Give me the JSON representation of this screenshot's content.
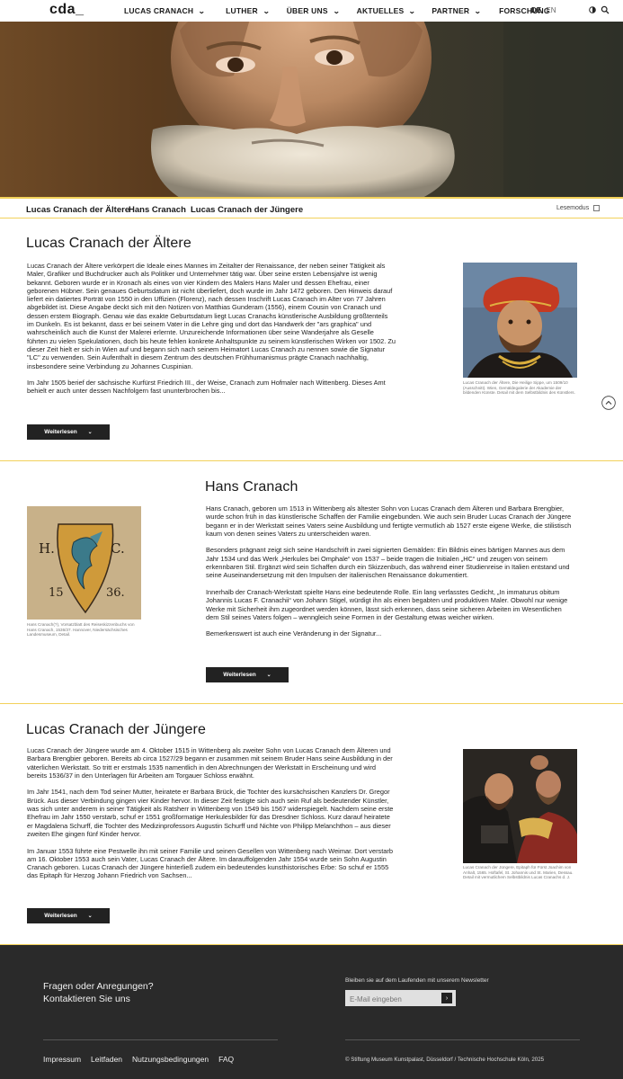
{
  "header": {
    "logo": "cda_",
    "nav": [
      {
        "label": "LUCAS CRANACH",
        "has_dropdown": true
      },
      {
        "label": "LUTHER",
        "has_dropdown": true
      },
      {
        "label": "ÜBER UNS",
        "has_dropdown": true
      },
      {
        "label": "AKTUELLES",
        "has_dropdown": true
      },
      {
        "label": "PARTNER",
        "has_dropdown": true
      },
      {
        "label": "FORSCHUNG",
        "has_dropdown": false
      }
    ],
    "lang_active": "DE",
    "lang_other": "EN",
    "icons": [
      "theme-toggle-icon",
      "search-icon"
    ]
  },
  "subnav": {
    "items": [
      "Lucas Cranach der Ältere",
      "Hans Cranach",
      "Lucas Cranach der Jüngere"
    ],
    "reading_mode_label": "Lesemodus"
  },
  "sections": [
    {
      "title": "Lucas Cranach der Ältere",
      "paragraphs": [
        "Lucas Cranach der Ältere verkörpert die Ideale eines Mannes im  Zeitalter der Renaissance, der neben seiner Tätigkeit als Maler,  Grafiker und Buchdrucker auch als Politiker und Unternehmer tätig war.  Über seine ersten Lebensjahre ist wenig bekannt. Geboren wurde er in  Kronach als eines von vier Kindern des Malers Hans Maler und dessen  Ehefrau, einer geborenen Hübner. Sein genaues Geburtsdatum ist nicht  überliefert, doch wurde im Jahr 1472 geboren. Den Hinweis darauf liefert ein datiertes Porträt von 1550 in den Uffizien (Florenz), nach dessen  Inschrift Lucas Cranach im Alter von 77 Jahren abgebildet ist. Diese  Angabe deckt sich mit den Notizen von Matthias Gunderam (1556), einem Cousin von Cranach und dessen erstem Biograph. Genau wie das exakte Geburtsdatum liegt Lucas Cranachs künstlerische  Ausbildung größtenteils im Dunkeln. Es ist bekannt, dass er bei seinem  Vater in die Lehre ging und dort das Handwerk der \"ars graphica\" und  wahrscheinlich auch die Kunst der Malerei erlernte. Unzureichende Informationen über seine Wanderjahre als Geselle führten zu vielen  Spekulationen, doch bis heute fehlen konkrete Anhaltspunkte zu seinem  künstlerischen Wirken vor 1502. Zu dieser Zeit hielt er sich in Wien auf und begann sich nach seinem Heimatort Lucas Cranach zu nennen sowie die Signatur \"LC\" zu verwenden. Sein Aufenthalt in diesem Zentrum des  deutschen Frühhumanismus prägte Cranach nachhaltig, insbesondere seine  Verbindung zu Johannes Cuspinian.",
        "Im Jahr 1505 berief der sächsische Kurfürst Friedrich III., der  Weise, Cranach zum Hofmaler nach Wittenberg. Dieses Amt behielt er auch  unter dessen Nachfolgern fast ununterbrochen bis..."
      ],
      "caption": "Lucas Cranach der Ältere, Die Heilige Sippe, um 1509/10 (Ausschnitt). Wien, Gemäldegalerie der Akademie der bildenden Künste. Detail mit dem Selbstbildnis des Künstlers.",
      "button_label": "Weiterlesen"
    },
    {
      "title": "Hans Cranach",
      "paragraphs": [
        "Hans Cranach, geboren um 1513 in Wittenberg als ältester Sohn von Lucas Cranach dem Älteren und Barbara Brengbier, wurde schon früh in das künstlerische Schaffen der Familie eingebunden. Wie auch sein Bruder Lucas Cranach der Jüngere begann er in der Werkstatt seines Vaters seine Ausbildung und fertigte vermutlich ab 1527 erste eigene Werke, die stilistisch kaum von denen seines Vaters zu unterscheiden waren.",
        "Besonders prägnant zeigt sich seine Handschrift in zwei signierten Gemälden: Ein Bildnis eines bärtigen Mannes aus dem Jahr 1534 und das Werk „Herkules bei Omphale“ von 1537 – beide tragen die Initialen „HC“ und zeugen von seinem erkennbaren Stil. Ergänzt wird sein Schaffen durch ein Skizzenbuch, das während einer Studienreise in Italien entstand und seine Auseinandersetzung mit den Impulsen der italienischen Renaissance dokumentiert.",
        "Innerhalb der Cranach-Werkstatt spielte Hans eine bedeutende Rolle. Ein lang verfasstes Gedicht, „In immaturus obitum Johannis Lucas F. Cranachii“ von Johann Stigel, würdigt ihn als einen begabten und produktiven Maler. Obwohl nur wenige Werke mit Sicherheit ihm zugeordnet werden können, lässt sich erkennen, dass seine sicheren Arbeiten im Wesentlichen dem Stil seines Vaters folgen – wenngleich seine Formen in der Gestaltung etwas weicher wirken.",
        "Bemerkenswert ist auch eine Veränderung in der Signatur..."
      ],
      "image_text": {
        "h": "H.",
        "c": "C.",
        "year_a": "15",
        "year_b": "36."
      },
      "caption": "Hans Cranach(?), Vorsatzblatt des Reiseskizzenbuchs von Hans Cranach, 1536/37. Hannover, Niedersächsisches Landesmuseum, Detail.",
      "button_label": "Weiterlesen"
    },
    {
      "title": "Lucas Cranach der Jüngere",
      "paragraphs": [
        "Lucas Cranach der Jüngere wurde am 4. Oktober 1515 in Wittenberg als zweiter Sohn von Lucas Cranach dem Älteren und Barbara Brengbier geboren. Bereits ab circa 1527/29 begann er zusammen mit seinem Bruder Hans seine Ausbildung in der väterlichen Werkstatt. So tritt er erstmals 1535 namentlich in den Abrechnungen der Werkstatt in Erscheinung und wird bereits 1536/37 in den Unterlagen für Arbeiten am Torgauer Schloss erwähnt.",
        "Im Jahr 1541, nach dem Tod seiner Mutter, heiratete er Barbara Brück, die Tochter des kursächsischen Kanzlers Dr. Gregor Brück. Aus dieser Verbindung gingen vier Kinder hervor. In dieser Zeit festigte sich auch sein Ruf als bedeutender Künstler, was sich unter anderem in seiner Tätigkeit als Ratsherr in Wittenberg von 1549 bis 1567 widerspiegelt. Nachdem seine erste Ehefrau im Jahr 1550 verstarb, schuf er 1551 großformatige Herkulesbilder für das Dresdner Schloss. Kurz darauf heiratete er Magdalena Schurff, die Tochter des Medizinprofessors Augustin Schurff und Nichte von Philipp Melanchthon – aus dieser zweiten Ehe gingen fünf Kinder hervor.",
        "Im Januar 1553 führte eine Pestwelle ihn mit seiner Familie und seinen Gesellen von Wittenberg nach Weimar. Dort verstarb am 16. Oktober 1553 auch sein Vater, Lucas Cranach der Ältere. Im darauffolgenden Jahr 1554 wurde sein Sohn Augustin Cranach geboren. Lucas Cranach der Jüngere hinterließ zudem ein bedeutendes kunsthistorisches Erbe: So schuf er 1555 das Epitaph für Herzog Johann Friedrich von Sachsen..."
      ],
      "caption": "Lucas Cranach der Jüngere, Epitaph für Fürst Joachim von Anhalt, 1565. Hoftafel, St. Johannis und St. Marien, Dessau. Detail mit vermutlichem Selbstbildnis Lucas Cranachs d. J.",
      "button_label": "Weiterlesen"
    }
  ],
  "footer": {
    "question_line1": "Fragen oder Anregungen?",
    "question_line2": "Kontaktieren Sie uns",
    "newsletter_label": "Bleiben sie auf dem Laufenden mit unserem Newsletter",
    "email_placeholder": "E-Mail eingeben",
    "links": [
      "Impressum",
      "Leitfaden",
      "Nutzungsbedingungen",
      "FAQ"
    ],
    "copyright": "© Stiftung Museum Kunstpalast, Düsseldorf / Technische Hochschule Köln, 2025"
  },
  "colors": {
    "accent": "#f2d15a",
    "footer_bg": "#2a2a2a",
    "button_bg": "#222222"
  }
}
